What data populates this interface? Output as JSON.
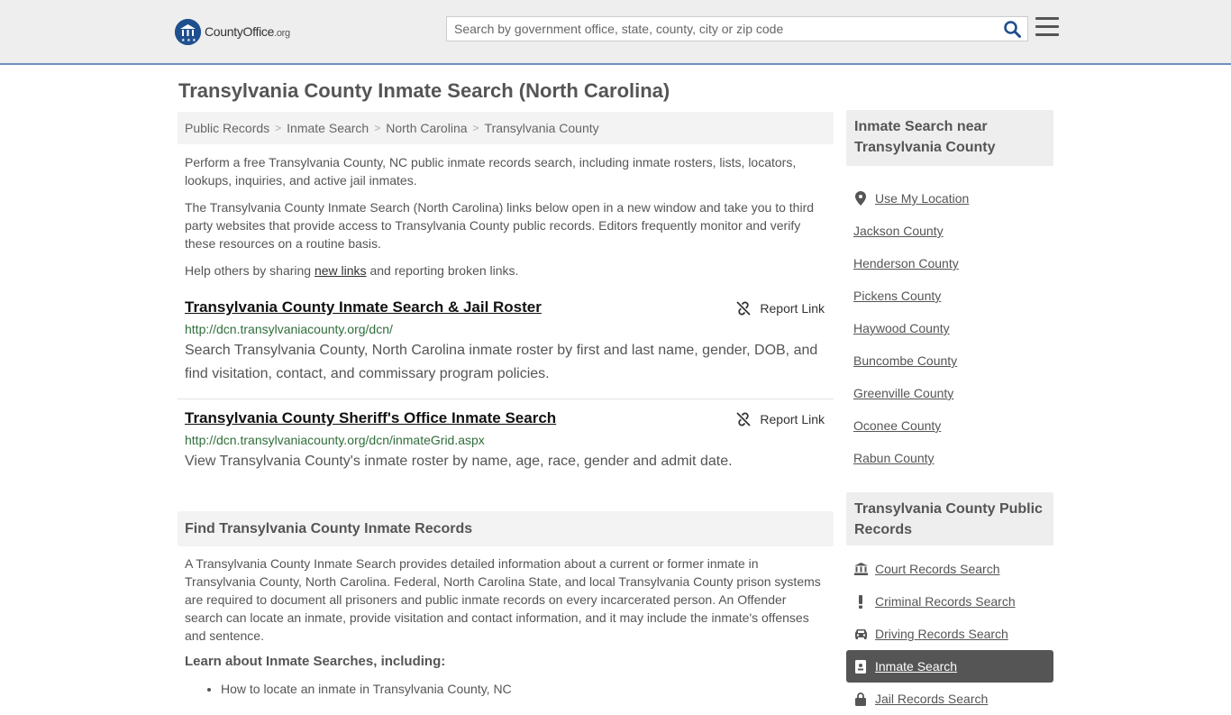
{
  "header": {
    "logo_text": "CountyOffice",
    "logo_org": ".org",
    "search_placeholder": "Search by government office, state, county, city or zip code"
  },
  "page_title": "Transylvania County Inmate Search (North Carolina)",
  "breadcrumb": [
    "Public Records",
    "Inmate Search",
    "North Carolina",
    "Transylvania County"
  ],
  "intro": {
    "p1": "Perform a free Transylvania County, NC public inmate records search, including inmate rosters, lists, locators, lookups, inquiries, and active jail inmates.",
    "p2": "The Transylvania County Inmate Search (North Carolina) links below open in a new window and take you to third party websites that provide access to Transylvania County public records. Editors frequently monitor and verify these resources on a routine basis.",
    "p3_before": "Help others by sharing ",
    "p3_link": "new links",
    "p3_after": " and reporting broken links."
  },
  "links": [
    {
      "title": "Transylvania County Inmate Search & Jail Roster",
      "report_label": "Report Link",
      "url": "http://dcn.transylvaniacounty.org/dcn/",
      "desc": "Search Transylvania County, North Carolina inmate roster by first and last name, gender, DOB, and find visitation, contact, and commissary program policies."
    },
    {
      "title": "Transylvania County Sheriff's Office Inmate Search",
      "report_label": "Report Link",
      "url": "http://dcn.transylvaniacounty.org/dcn/inmateGrid.aspx",
      "desc": "View Transylvania County's inmate roster by name, age, race, gender and admit date."
    }
  ],
  "find_section": {
    "heading": "Find Transylvania County Inmate Records",
    "body": "A Transylvania County Inmate Search provides detailed information about a current or former inmate in Transylvania County, North Carolina. Federal, North Carolina State, and local Transylvania County prison systems are required to document all prisoners and public inmate records on every incarcerated person. An Offender search can locate an inmate, provide visitation and contact information, and it may include the inmate's offenses and sentence.",
    "learn_heading": "Learn about Inmate Searches, including:",
    "bullets": [
      "How to locate an inmate in Transylvania County, NC"
    ]
  },
  "sidebar": {
    "nearby_heading": "Inmate Search near Transylvania County",
    "use_location": "Use My Location",
    "nearby": [
      "Jackson County",
      "Henderson County",
      "Pickens County",
      "Haywood County",
      "Buncombe County",
      "Greenville County",
      "Oconee County",
      "Rabun County"
    ],
    "records_heading": "Transylvania County Public Records",
    "records": [
      {
        "label": "Court Records Search",
        "icon": "courthouse-icon"
      },
      {
        "label": "Criminal Records Search",
        "icon": "exclamation-icon"
      },
      {
        "label": "Driving Records Search",
        "icon": "car-icon"
      },
      {
        "label": "Inmate Search",
        "icon": "id-badge-icon"
      },
      {
        "label": "Jail Records Search",
        "icon": "lock-icon"
      }
    ]
  },
  "colors": {
    "header_bg": "#eeeeee",
    "header_border": "#6f8fbf",
    "url_green": "#2f6e3b",
    "active_bg": "#555555"
  }
}
